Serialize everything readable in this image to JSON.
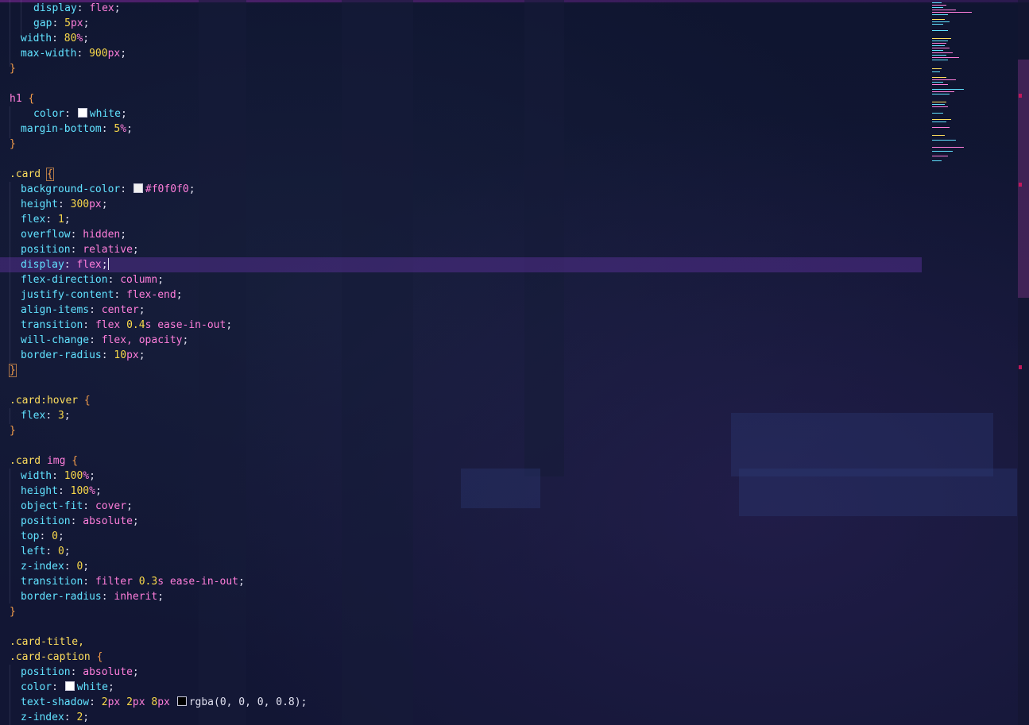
{
  "editor": {
    "language": "css",
    "theme_colors": {
      "background": "#111633",
      "property": "#61e2ff",
      "value": "#ff7edb",
      "number": "#f9d84a",
      "selector": "#fede5d",
      "brace": "#f39c4a",
      "active_line": "#5f32a0"
    }
  },
  "code": {
    "l1": {
      "prop": "display",
      "value": "flex"
    },
    "l2": {
      "prop": "gap",
      "num": "5",
      "unit": "px"
    },
    "l3": {
      "prop": "width",
      "num": "80",
      "unit": "%"
    },
    "l4": {
      "prop": "max-width",
      "num": "900",
      "unit": "px"
    },
    "l5": {
      "brace": "}"
    },
    "l7": {
      "selector": "h1",
      "brace": "{"
    },
    "l8": {
      "prop": "color",
      "swatch": "#ffffff",
      "value": "white"
    },
    "l9": {
      "prop": "margin-bottom",
      "num": "5",
      "unit": "%"
    },
    "l10": {
      "brace": "}"
    },
    "l12": {
      "selector": ".card",
      "brace": "{"
    },
    "l13": {
      "prop": "background-color",
      "swatch": "#f0f0f0",
      "value": "#f0f0f0"
    },
    "l14": {
      "prop": "height",
      "num": "300",
      "unit": "px"
    },
    "l15": {
      "prop": "flex",
      "num": "1"
    },
    "l16": {
      "prop": "overflow",
      "value": "hidden"
    },
    "l17": {
      "prop": "position",
      "value": "relative"
    },
    "l18": {
      "prop": "display",
      "value": "flex"
    },
    "l19": {
      "prop": "flex-direction",
      "value": "column"
    },
    "l20": {
      "prop": "justify-content",
      "value": "flex-end"
    },
    "l21": {
      "prop": "align-items",
      "value": "center"
    },
    "l22": {
      "prop": "transition",
      "value": "flex",
      "num": "0.4",
      "unit": "s",
      "value2": "ease-in-out"
    },
    "l23": {
      "prop": "will-change",
      "value": "flex, opacity"
    },
    "l24": {
      "prop": "border-radius",
      "num": "10",
      "unit": "px"
    },
    "l25": {
      "brace": "}"
    },
    "l27": {
      "selector": ".card:hover",
      "brace": "{"
    },
    "l28": {
      "prop": "flex",
      "num": "3"
    },
    "l29": {
      "brace": "}"
    },
    "l31": {
      "selector": ".card",
      "tag": "img",
      "brace": "{"
    },
    "l32": {
      "prop": "width",
      "num": "100",
      "unit": "%"
    },
    "l33": {
      "prop": "height",
      "num": "100",
      "unit": "%"
    },
    "l34": {
      "prop": "object-fit",
      "value": "cover"
    },
    "l35": {
      "prop": "position",
      "value": "absolute"
    },
    "l36": {
      "prop": "top",
      "num": "0"
    },
    "l37": {
      "prop": "left",
      "num": "0"
    },
    "l38": {
      "prop": "z-index",
      "num": "0"
    },
    "l39": {
      "prop": "transition",
      "value": "filter",
      "num": "0.3",
      "unit": "s",
      "value2": "ease-in-out"
    },
    "l40": {
      "prop": "border-radius",
      "value": "inherit"
    },
    "l41": {
      "brace": "}"
    },
    "l43": {
      "selector": ".card-title,"
    },
    "l44": {
      "selector": ".card-caption",
      "brace": "{"
    },
    "l45": {
      "prop": "position",
      "value": "absolute"
    },
    "l46": {
      "prop": "color",
      "swatch": "#ffffff",
      "value": "white"
    },
    "l47": {
      "prop": "text-shadow",
      "n1": "2",
      "u1": "px",
      "n2": "2",
      "u2": "px",
      "n3": "8",
      "u3": "px",
      "swatch": "#000000",
      "value": "rgba(0, 0, 0, 0.8)"
    },
    "l48": {
      "prop": "z-index",
      "num": "2"
    }
  }
}
